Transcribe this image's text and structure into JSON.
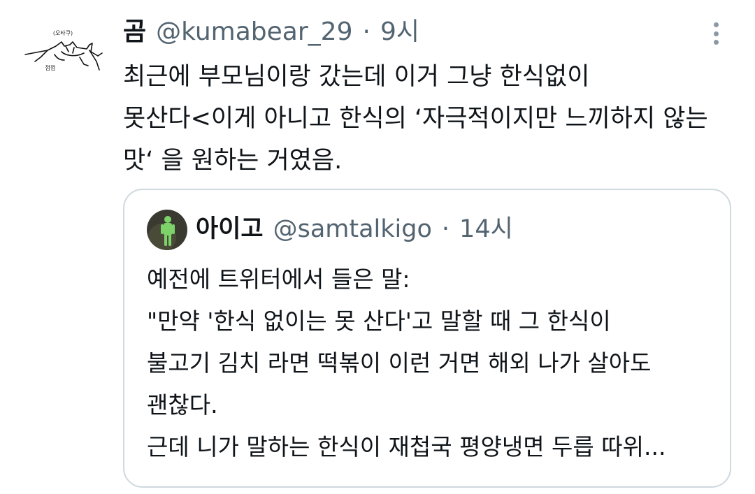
{
  "tweet": {
    "author": {
      "name": "곰",
      "handle": "@kumabear_29",
      "time": "9시",
      "avatar_text_top": "(오타쿠)",
      "avatar_text_bottom": "껍껍"
    },
    "separator": "·",
    "body_lines": [
      "최근에 부모님이랑 갔는데 이거 그냥 한식없이",
      "못산다<이게 아니고 한식의 ‘자극적이지만 느끼하지 않는",
      "맛‘ 을 원하는 거였음."
    ],
    "more_icon": "more-vertical-icon"
  },
  "quoted_tweet": {
    "author": {
      "name": "아이고",
      "handle": "@samtalkigo",
      "time": "14시"
    },
    "separator": "·",
    "body_lines": [
      "예전에 트위터에서 들은 말:",
      "\"만약 '한식 없이는 못 산다'고 말할 때 그 한식이",
      "불고기 김치 라면 떡볶이 이런 거면 해외 나가 살아도",
      "괜찮다.",
      "근데 니가 말하는 한식이 재첩국 평양냉면 두릅 따위..."
    ]
  },
  "colors": {
    "text_primary": "#0f1419",
    "text_secondary": "#536471",
    "border": "#cfd9de",
    "icon_gray": "#8b98a5"
  }
}
